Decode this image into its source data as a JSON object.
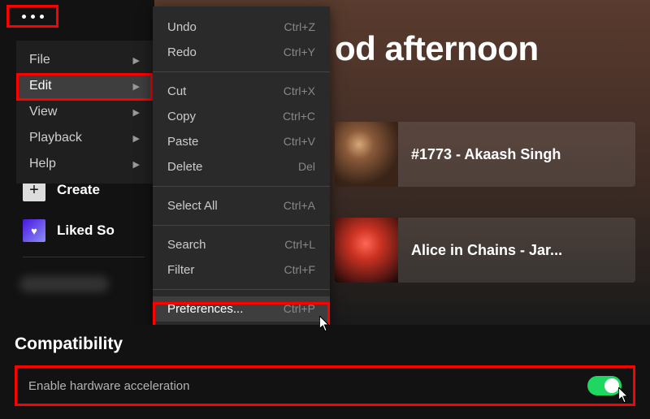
{
  "greeting": "od afternoon",
  "menubar": {
    "items": [
      {
        "label": "File"
      },
      {
        "label": "Edit"
      },
      {
        "label": "View"
      },
      {
        "label": "Playback"
      },
      {
        "label": "Help"
      }
    ]
  },
  "edit_menu": {
    "undo": {
      "label": "Undo",
      "shortcut": "Ctrl+Z"
    },
    "redo": {
      "label": "Redo",
      "shortcut": "Ctrl+Y"
    },
    "cut": {
      "label": "Cut",
      "shortcut": "Ctrl+X"
    },
    "copy": {
      "label": "Copy",
      "shortcut": "Ctrl+C"
    },
    "paste": {
      "label": "Paste",
      "shortcut": "Ctrl+V"
    },
    "delete": {
      "label": "Delete",
      "shortcut": "Del"
    },
    "select_all": {
      "label": "Select All",
      "shortcut": "Ctrl+A"
    },
    "search": {
      "label": "Search",
      "shortcut": "Ctrl+L"
    },
    "filter": {
      "label": "Filter",
      "shortcut": "Ctrl+F"
    },
    "preferences": {
      "label": "Preferences...",
      "shortcut": "Ctrl+P"
    }
  },
  "sidebar": {
    "create": "Create",
    "liked": "Liked So"
  },
  "cards": [
    {
      "title": "#1773 - Akaash Singh"
    },
    {
      "title": "Alice in Chains - Jar..."
    }
  ],
  "compat": {
    "heading": "Compatibility",
    "hw_accel": "Enable hardware acceleration"
  }
}
